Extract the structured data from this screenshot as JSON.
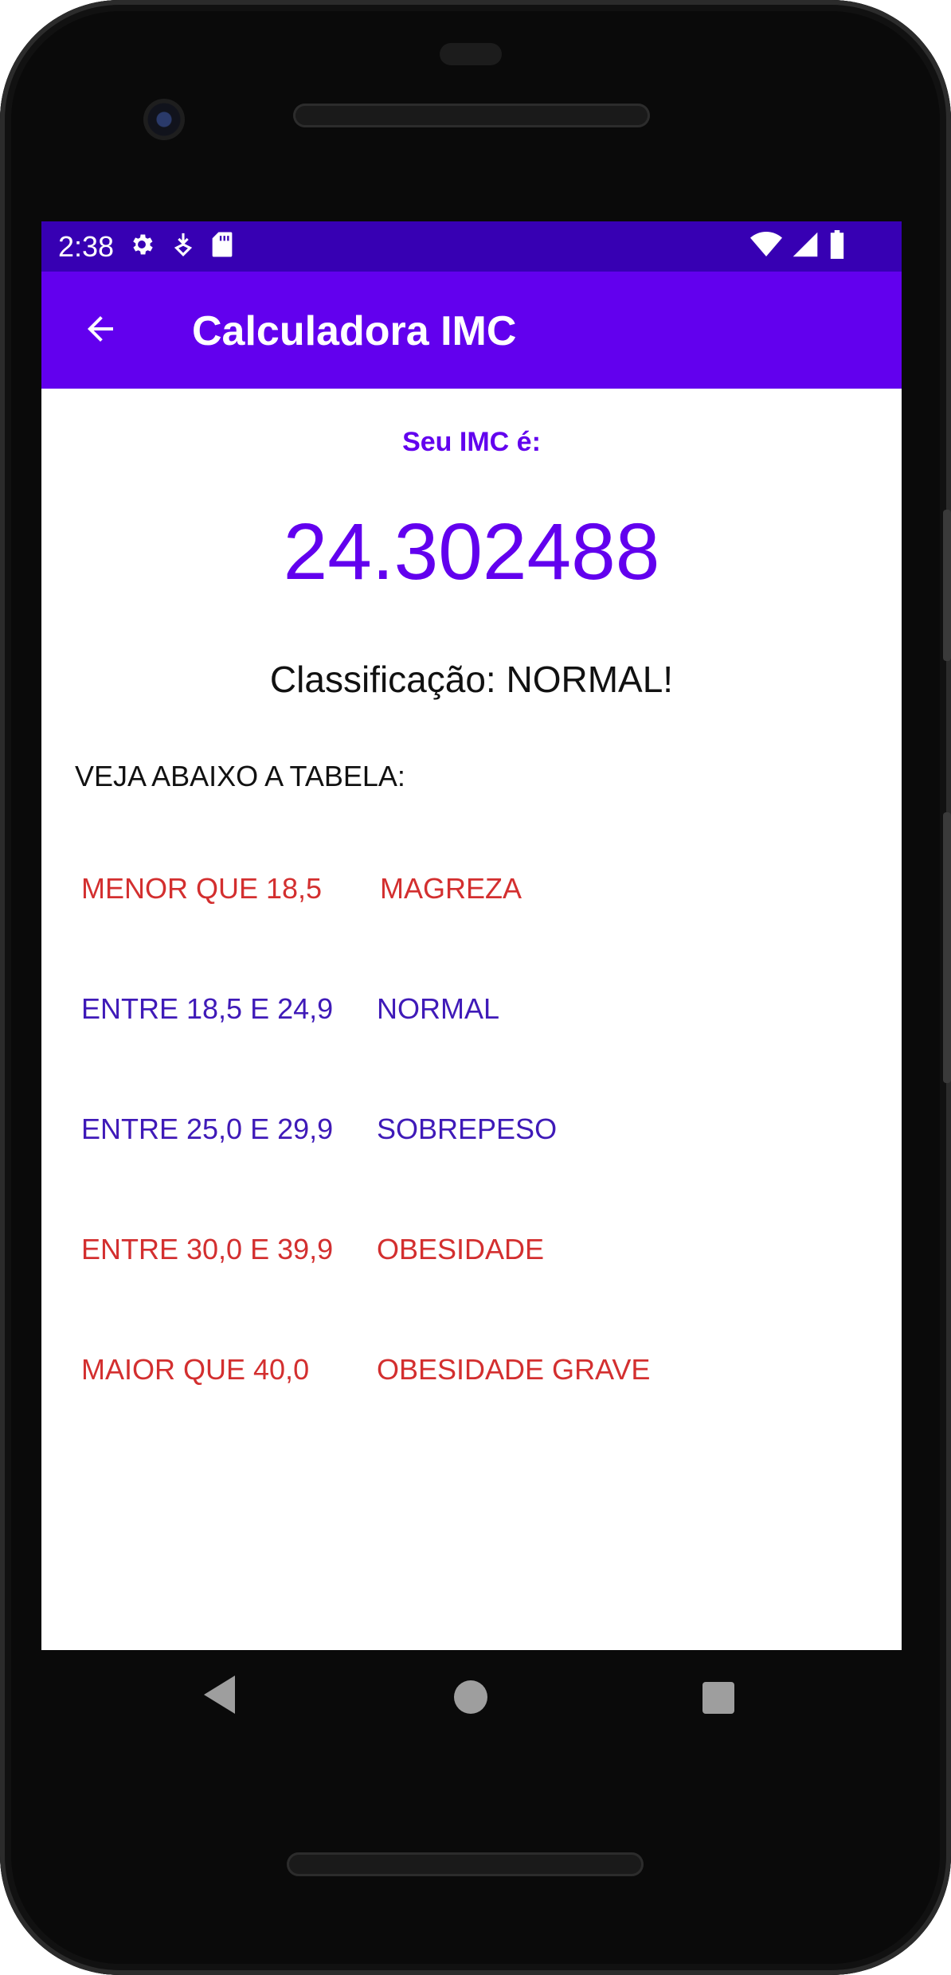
{
  "status_bar": {
    "time": "2:38",
    "left_icons": [
      "gear-icon",
      "download-icon",
      "sd-card-icon"
    ],
    "right_icons": [
      "wifi-icon",
      "signal-icon",
      "battery-icon"
    ]
  },
  "app_bar": {
    "title": "Calculadora IMC",
    "back_icon": "arrow-left-icon"
  },
  "result": {
    "label": "Seu IMC é:",
    "value": "24.302488",
    "classification": "Classificação: NORMAL!"
  },
  "table": {
    "title": "VEJA ABAIXO A TABELA:",
    "rows": [
      {
        "range": "MENOR QUE 18,5",
        "category": "MAGREZA",
        "color": "#d32f2f"
      },
      {
        "range": "ENTRE 18,5 E 24,9",
        "category": "NORMAL",
        "color": "#3f1ab8"
      },
      {
        "range": "ENTRE 25,0 E 29,9",
        "category": "SOBREPESO",
        "color": "#3f1ab8"
      },
      {
        "range": "ENTRE 30,0 E 39,9",
        "category": "OBESIDADE",
        "color": "#d32f2f"
      },
      {
        "range": "MAIOR QUE 40,0",
        "category": "OBESIDADE GRAVE",
        "color": "#d32f2f"
      }
    ]
  },
  "colors": {
    "status_bar": "#3700b3",
    "app_bar": "#6200ee",
    "accent": "#6200ee"
  },
  "nav_bar": {
    "icons": [
      "nav-back-icon",
      "nav-home-icon",
      "nav-recents-icon"
    ]
  }
}
